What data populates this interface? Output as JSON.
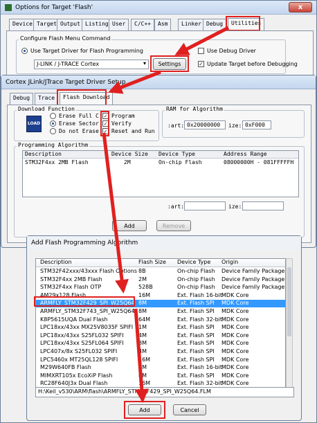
{
  "options_window": {
    "title": "Options for Target 'Flash'",
    "close": "x",
    "tabs": [
      "Device",
      "Target",
      "Output",
      "Listing",
      "User",
      "C/C++",
      "Asm",
      "Linker",
      "Debug",
      "Utilities"
    ],
    "group_label": "Configure Flash Menu Command",
    "use_target_driver": "Use Target Driver for Flash Programming",
    "driver_select": "J-LINK / J-TRACE Cortex",
    "settings_button": "Settings",
    "use_debug_driver": "Use Debug Driver",
    "update_target": "Update Target before Debugging"
  },
  "cortex_window": {
    "title": "Cortex JLink/JTrace Target Driver Setup",
    "tabs": [
      "Debug",
      "Trace",
      "Flash Download"
    ],
    "download_function_label": "Download Function",
    "load_icon_text": "LOAD",
    "erase_options": [
      "Erase Full C",
      "Erase Sector",
      "Do not Erase"
    ],
    "checks": [
      "Program",
      "Verify",
      "Reset and Run"
    ],
    "ram_label": "RAM for Algorithm",
    "ram_start_label": ":art:",
    "ram_start_value": "0x20000000",
    "ram_size_label": "ize:",
    "ram_size_value": "0xF000",
    "prog_algo_label": "Programming Algorithm",
    "columns": [
      "Description",
      "Device Size",
      "Device Type",
      "Address Range"
    ],
    "algorithms": [
      {
        "description": "STM32F4xx 2MB Flash",
        "size": "2M",
        "type": "On-chip Flash",
        "range": "08000000H - 081FFFFFH"
      }
    ],
    "start_label": ":art:",
    "size_label": "ize:",
    "add_button": "Add",
    "remove_button": "Remove"
  },
  "add_dialog": {
    "title": "Add Flash Programming Algorithm",
    "columns": [
      "Description",
      "Flash Size",
      "Device Type",
      "Origin"
    ],
    "rows": [
      {
        "description": "STM32F42xxx/43xxx Flash Options",
        "size": "8B",
        "type": "On-chip Flash",
        "origin": "Device Family Package"
      },
      {
        "description": "STM32F4xx 2MB Flash",
        "size": "2M",
        "type": "On-chip Flash",
        "origin": "Device Family Package"
      },
      {
        "description": "STM32F4xx Flash OTP",
        "size": "528B",
        "type": "On-chip Flash",
        "origin": "Device Family Package"
      },
      {
        "description": "AM29x128 Flash",
        "size": "16M",
        "type": "Ext. Flash 16-bit",
        "origin": "MDK Core"
      },
      {
        "description": "ARMFLY_STM32F429_SPI_W25Q64",
        "size": "8M",
        "type": "Ext. Flash SPI",
        "origin": "MDK Core"
      },
      {
        "description": "ARMFLY_STM32F743_SPI_W25Q64",
        "size": "8M",
        "type": "Ext. Flash SPI",
        "origin": "MDK Core"
      },
      {
        "description": "K8P5615UQA Dual Flash",
        "size": "64M",
        "type": "Ext. Flash 32-bit",
        "origin": "MDK Core"
      },
      {
        "description": "LPC18xx/43xx MX25V8035F SPIFI",
        "size": "1M",
        "type": "Ext. Flash SPI",
        "origin": "MDK Core"
      },
      {
        "description": "LPC18xx/43xx S25FL032 SPIFI",
        "size": "4M",
        "type": "Ext. Flash SPI",
        "origin": "MDK Core"
      },
      {
        "description": "LPC18xx/43xx S25FL064 SPIFI",
        "size": "8M",
        "type": "Ext. Flash SPI",
        "origin": "MDK Core"
      },
      {
        "description": "LPC407x/8x S25FL032 SPIFI",
        "size": "4M",
        "type": "Ext. Flash SPI",
        "origin": "MDK Core"
      },
      {
        "description": "LPC5460x MT25QL128 SPIFI",
        "size": "16M",
        "type": "Ext. Flash SPI",
        "origin": "MDK Core"
      },
      {
        "description": "M29W640FB Flash",
        "size": "8M",
        "type": "Ext. Flash 16-bit",
        "origin": "MDK Core"
      },
      {
        "description": "MIMXRT105x EcoXiP Flash",
        "size": "8M",
        "type": "Ext. Flash SPI",
        "origin": "MDK Core"
      },
      {
        "description": "RC28F640J3x Dual Flash",
        "size": "16M",
        "type": "Ext. Flash 32-bit",
        "origin": "MDK Core"
      }
    ],
    "selected_index": 4,
    "path": "H:\\Keil_v530\\ARM\\flash\\ARMFLY_STM32F429_SPI_W25Q64.FLM",
    "add_button": "Add",
    "cancel_button": "Cancel"
  },
  "colors": {
    "annotation": "#e02020",
    "selection": "#3399ff"
  }
}
